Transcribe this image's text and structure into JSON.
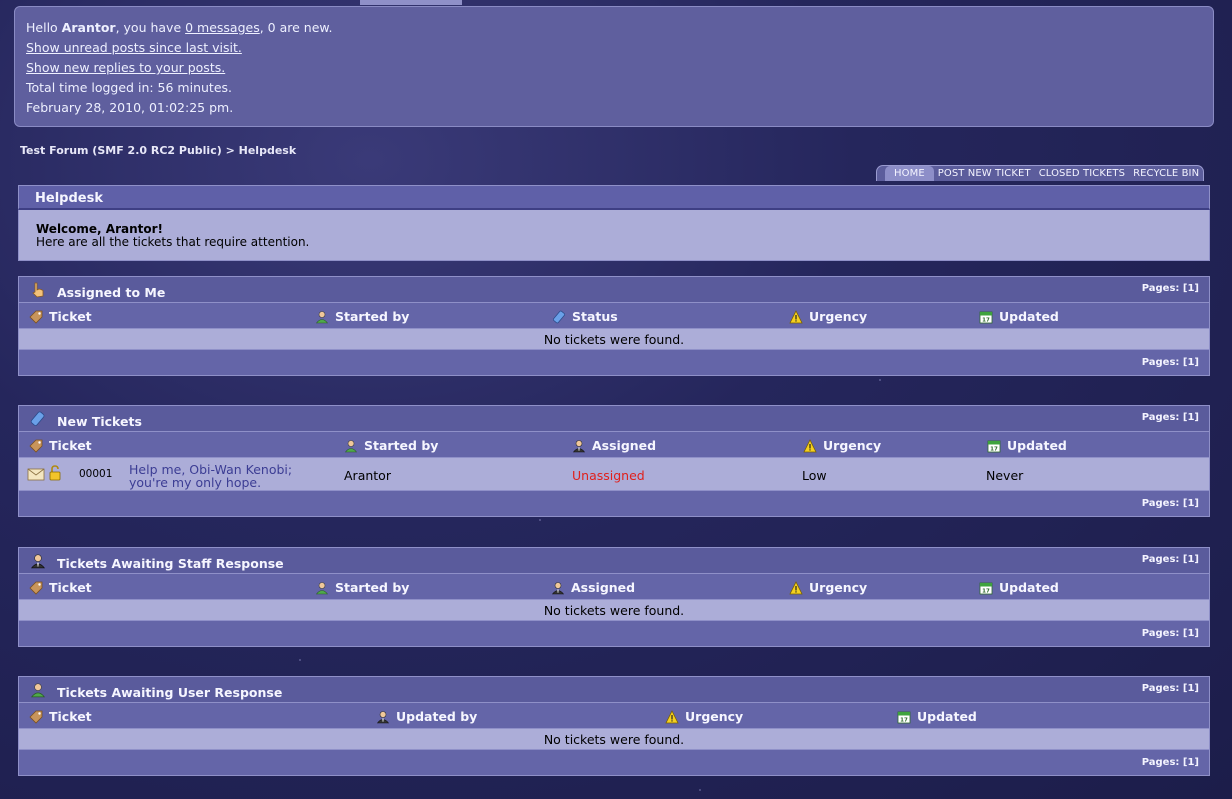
{
  "userbox": {
    "greeting_prefix": "Hello ",
    "username": "Arantor",
    "greeting_mid": ", you have ",
    "messages_link": "0 messages",
    "greeting_suffix": ", 0 are new.",
    "unread_link": "Show unread posts since last visit.",
    "replies_link": "Show new replies to your posts.",
    "time_logged": "Total time logged in: 56 minutes.",
    "datetime": "February 28, 2010, 01:02:25 pm."
  },
  "breadcrumb": {
    "forum": "Test Forum (SMF 2.0 RC2 Public)",
    "separator": " > ",
    "current": "Helpdesk"
  },
  "menu": {
    "items": [
      "HOME",
      "POST NEW TICKET",
      "CLOSED TICKETS",
      "RECYCLE BIN"
    ],
    "active": "HOME"
  },
  "helpdesk": {
    "title": "Helpdesk",
    "welcome_title": "Welcome, Arantor!",
    "welcome_text": "Here are all the tickets that require attention."
  },
  "pages_label": "Pages: [1]",
  "empty_text": "No tickets were found.",
  "panels": {
    "assigned": {
      "title": "Assigned to Me",
      "columns": [
        "Ticket",
        "Started by",
        "Status",
        "Urgency",
        "Updated"
      ]
    },
    "new": {
      "title": "New Tickets",
      "columns": [
        "Ticket",
        "Started by",
        "Assigned",
        "Urgency",
        "Updated"
      ],
      "rows": [
        {
          "id": "00001",
          "subject_line1": "Help me, Obi-Wan Kenobi;",
          "subject_line2": "you're my only hope.",
          "started_by": "Arantor",
          "assigned": "Unassigned",
          "urgency": "Low",
          "updated": "Never"
        }
      ]
    },
    "staff": {
      "title": "Tickets Awaiting Staff Response",
      "columns": [
        "Ticket",
        "Started by",
        "Assigned",
        "Urgency",
        "Updated"
      ]
    },
    "user": {
      "title": "Tickets Awaiting User Response",
      "columns": [
        "Ticket",
        "Updated by",
        "Urgency",
        "Updated"
      ]
    }
  },
  "icons": {
    "ticket": "ticket-icon",
    "user": "user-icon",
    "status": "status-icon",
    "staff": "staff-icon",
    "urgency": "warning-icon",
    "updated": "calendar-icon"
  },
  "colors": {
    "unassigned": "#e0201c",
    "link": "#3c3d94",
    "panel": "#5a5b9c",
    "row_bg": "#acadd8"
  }
}
